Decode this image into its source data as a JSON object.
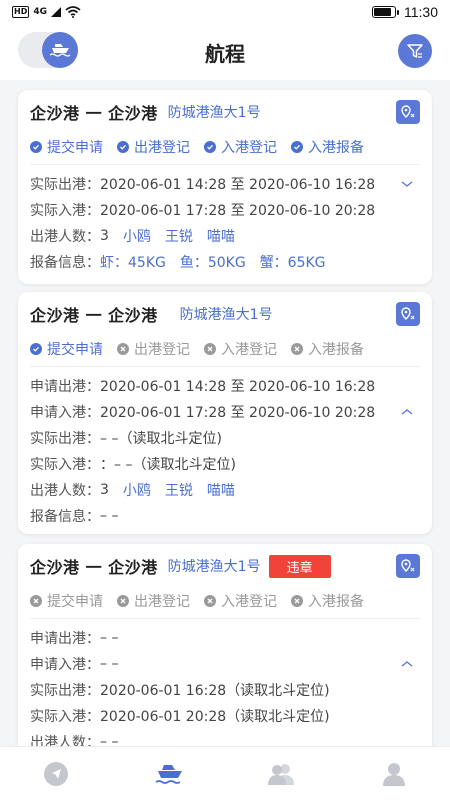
{
  "status_bar": {
    "left_labels": [
      "HD",
      "4G"
    ],
    "time": "11:30",
    "battery_level": 0.9
  },
  "header": {
    "title": "航程",
    "toggle_icon": "ship-icon",
    "filter_icon": "filter-icon"
  },
  "colors": {
    "accent": "#5b78d6",
    "link": "#4a6fd0",
    "violation": "#f0433a",
    "muted": "#999999"
  },
  "cards": [
    {
      "route": "企沙港 一 企沙港",
      "vessel": "防城港渔大1号",
      "badge": "",
      "steps": [
        {
          "label": "提交申请",
          "done": true
        },
        {
          "label": "出港登记",
          "done": true
        },
        {
          "label": "入港登记",
          "done": true
        },
        {
          "label": "入港报备",
          "done": true
        }
      ],
      "rows": {
        "actual_depart": {
          "label": "实际出港：",
          "value": "2020-06-01 14:28 至 2020-06-10 16:28"
        },
        "actual_arrive": {
          "label": "实际入港：",
          "value": "2020-06-01 17:28 至 2020-06-10 20:28"
        },
        "crew": {
          "label": "出港人数：",
          "count": "3",
          "names": [
            "小鸥",
            "王锐",
            "喵喵"
          ]
        },
        "report": {
          "label": "报备信息：",
          "items": [
            "虾：45KG",
            "鱼：50KG",
            "蟹：65KG"
          ]
        }
      }
    },
    {
      "route": "企沙港 一 企沙港",
      "vessel": "防城港渔大1号",
      "badge": "",
      "steps": [
        {
          "label": "提交申请",
          "done": true
        },
        {
          "label": "出港登记",
          "done": false
        },
        {
          "label": "入港登记",
          "done": false
        },
        {
          "label": "入港报备",
          "done": false
        }
      ],
      "rows": {
        "apply_depart": {
          "label": "申请出港：",
          "value": "2020-06-01 14:28 至 2020-06-10 16:28"
        },
        "apply_arrive": {
          "label": "申请入港：",
          "value": "2020-06-01 17:28 至 2020-06-10 20:28"
        },
        "actual_depart": {
          "label": "实际出港：",
          "value": "– –（读取北斗定位)"
        },
        "actual_arrive": {
          "label": "实际入港：",
          "value": "：– –（读取北斗定位)"
        },
        "crew": {
          "label": "出港人数：",
          "count": "3",
          "names": [
            "小鸥",
            "王锐",
            "喵喵"
          ]
        },
        "report": {
          "label": "报备信息：",
          "value": "– –"
        }
      }
    },
    {
      "route": "企沙港 一 企沙港",
      "vessel": "防城港渔大1号",
      "badge": "违章",
      "steps": [
        {
          "label": "提交申请",
          "done": false
        },
        {
          "label": "出港登记",
          "done": false
        },
        {
          "label": "入港登记",
          "done": false
        },
        {
          "label": "入港报备",
          "done": false
        }
      ],
      "rows": {
        "apply_depart": {
          "label": "申请出港：",
          "value": "– –"
        },
        "apply_arrive": {
          "label": "申请入港：",
          "value": "– –"
        },
        "actual_depart": {
          "label": "实际出港：",
          "value": "2020-06-01 16:28（读取北斗定位)"
        },
        "actual_arrive": {
          "label": "实际入港：",
          "value": "2020-06-01 20:28（读取北斗定位)"
        },
        "crew": {
          "label": "出港人数：",
          "value": "– –"
        }
      }
    }
  ],
  "bottom_nav": [
    {
      "name": "navigate",
      "icon": "navigation-icon",
      "active": false
    },
    {
      "name": "voyage",
      "icon": "ship-icon",
      "active": true
    },
    {
      "name": "group",
      "icon": "group-icon",
      "active": false
    },
    {
      "name": "profile",
      "icon": "user-icon",
      "active": false
    }
  ]
}
